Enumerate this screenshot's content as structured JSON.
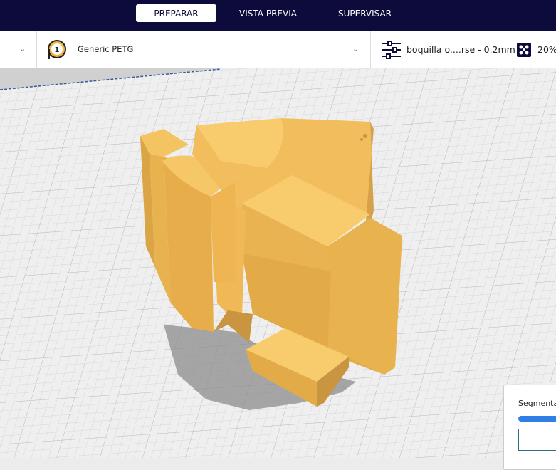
{
  "header": {
    "tabs": [
      {
        "label": "PREPARAR",
        "active": true
      },
      {
        "label": "VISTA PREVIA",
        "active": false
      },
      {
        "label": "SUPERVISAR",
        "active": false
      }
    ]
  },
  "toolbar": {
    "extruder_number": "1",
    "material": "Generic PETG",
    "profile": "boquilla o....rse - 0.2mm",
    "infill": "20%"
  },
  "slice_panel": {
    "label": "Segmenta",
    "progress": 1.0
  },
  "colors": {
    "header": "#0c0b3b",
    "model": "#f5c462",
    "accent": "#2f7fe6"
  }
}
